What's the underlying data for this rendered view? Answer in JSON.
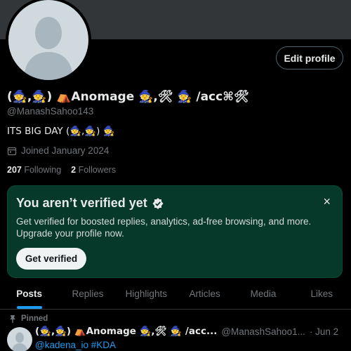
{
  "profile": {
    "name": "(🧙,🧙) ⛺Anomage 🧙,🛠 🧙 /acc⌘🛠",
    "handle": "@ManashSahoo143",
    "bio": "ITS BIG DAY (🧙,🧙) 🧙",
    "joined": "Joined January 2024",
    "joined_icon": "calendar-icon",
    "following_count": "207",
    "following_label": "Following",
    "followers_count": "2",
    "followers_label": "Followers",
    "edit_button": "Edit profile"
  },
  "verify": {
    "title": "You aren’t verified yet",
    "description": "Get verified for boosted replies, analytics, ad-free browsing, and more. Upgrade your profile now.",
    "button": "Get verified",
    "close": "×"
  },
  "tabs": [
    {
      "label": "Posts",
      "active": true
    },
    {
      "label": "Replies"
    },
    {
      "label": "Highlights"
    },
    {
      "label": "Articles"
    },
    {
      "label": "Media"
    },
    {
      "label": "Likes"
    }
  ],
  "pinned_post": {
    "pinned_label": "Pinned",
    "name": "(🧙,🧙) ⛺Anomage 🧙,🛠 🧙 /acc...",
    "handle": "@ManashSahoo1...",
    "date": "· Jun 2",
    "text": "@kadena_io #KDA",
    "more": "···"
  },
  "colors": {
    "accent": "#1d9bf0",
    "verify_bg": "#07392a",
    "muted": "#71767b",
    "text": "#e7e9ea"
  }
}
